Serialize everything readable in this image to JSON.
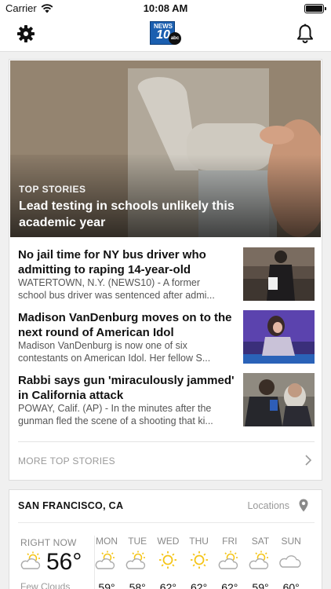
{
  "status_bar": {
    "carrier": "Carrier",
    "time": "10:08 AM"
  },
  "nav": {
    "logo_top": "NEWS",
    "logo_number": "10",
    "logo_badge": "abc"
  },
  "hero": {
    "kicker": "TOP STORIES",
    "title": "Lead testing in schools unlikely this academic year"
  },
  "stories": [
    {
      "title": "No jail time for NY bus driver who admitting to raping 14-year-old",
      "summary_line1": "WATERTOWN, N.Y. (NEWS10) - A former",
      "summary_line2": "school bus driver was sentenced after admi..."
    },
    {
      "title": "Madison VanDenburg moves on to the next round of American Idol",
      "summary_line1": "Madison VanDenburg is now one of six",
      "summary_line2": "contestants on American Idol. Her fellow S..."
    },
    {
      "title": "Rabbi says gun 'miraculously jammed' in California attack",
      "summary_line1": "POWAY, Calif. (AP) - In the minutes after the",
      "summary_line2": "gunman fled the scene of a shooting that ki..."
    }
  ],
  "more_stories_label": "MORE TOP STORIES",
  "weather": {
    "city": "SAN FRANCISCO, CA",
    "locations_label": "Locations",
    "now_label": "RIGHT NOW",
    "now_temp": "56°",
    "now_condition": "Few Clouds",
    "forecast": [
      {
        "day": "MON",
        "temp": "59°",
        "icon": "partly-sunny-icon"
      },
      {
        "day": "TUE",
        "temp": "58°",
        "icon": "partly-sunny-icon"
      },
      {
        "day": "WED",
        "temp": "62°",
        "icon": "sunny-icon"
      },
      {
        "day": "THU",
        "temp": "62°",
        "icon": "sunny-icon"
      },
      {
        "day": "FRI",
        "temp": "62°",
        "icon": "partly-sunny-icon"
      },
      {
        "day": "SAT",
        "temp": "59°",
        "icon": "partly-sunny-icon"
      },
      {
        "day": "SUN",
        "temp": "60°",
        "icon": "cloudy-icon"
      }
    ]
  },
  "colors": {
    "logo_blue": "#1b5fb0",
    "sun_yellow": "#f5c518",
    "muted_text": "#999999"
  }
}
